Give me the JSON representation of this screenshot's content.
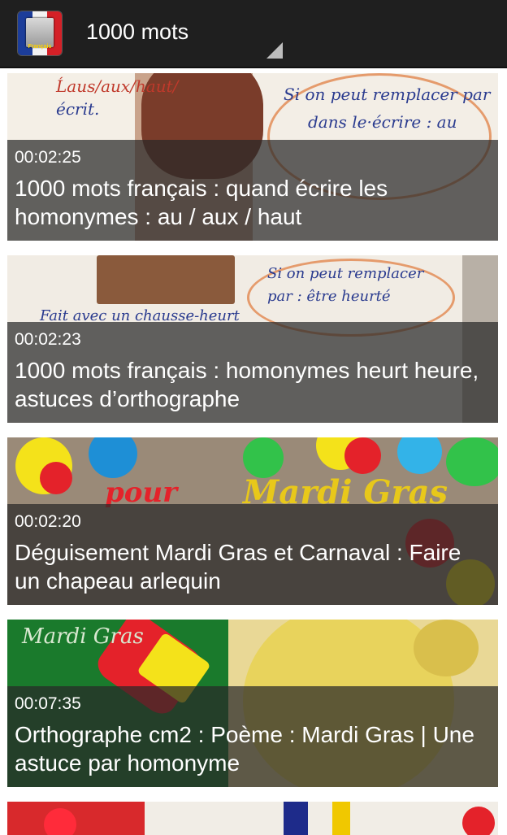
{
  "app": {
    "title": "1000 mots",
    "icon": "french-flag-book-icon",
    "icon_text": "Français",
    "colors": {
      "actionbar": "#1f1f1f",
      "flag_blue": "#1c3d9a",
      "flag_white": "#f2f2f2",
      "flag_red": "#d42027"
    }
  },
  "videos": [
    {
      "duration": "00:02:25",
      "title": "1000 mots français : quand écrire les homonymes : au / aux / haut"
    },
    {
      "duration": "00:02:23",
      "title": "1000 mots français : homonymes heurt heure, astuces d’orthographe"
    },
    {
      "duration": "00:02:20",
      "title": "Déguisement Mardi Gras et Carnaval : Faire un chapeau arlequin"
    },
    {
      "duration": "00:07:35",
      "title": "Orthographe cm2 : Poème : Mardi Gras | Une astuce par homonyme"
    },
    {
      "duration": "",
      "title": ""
    }
  ]
}
